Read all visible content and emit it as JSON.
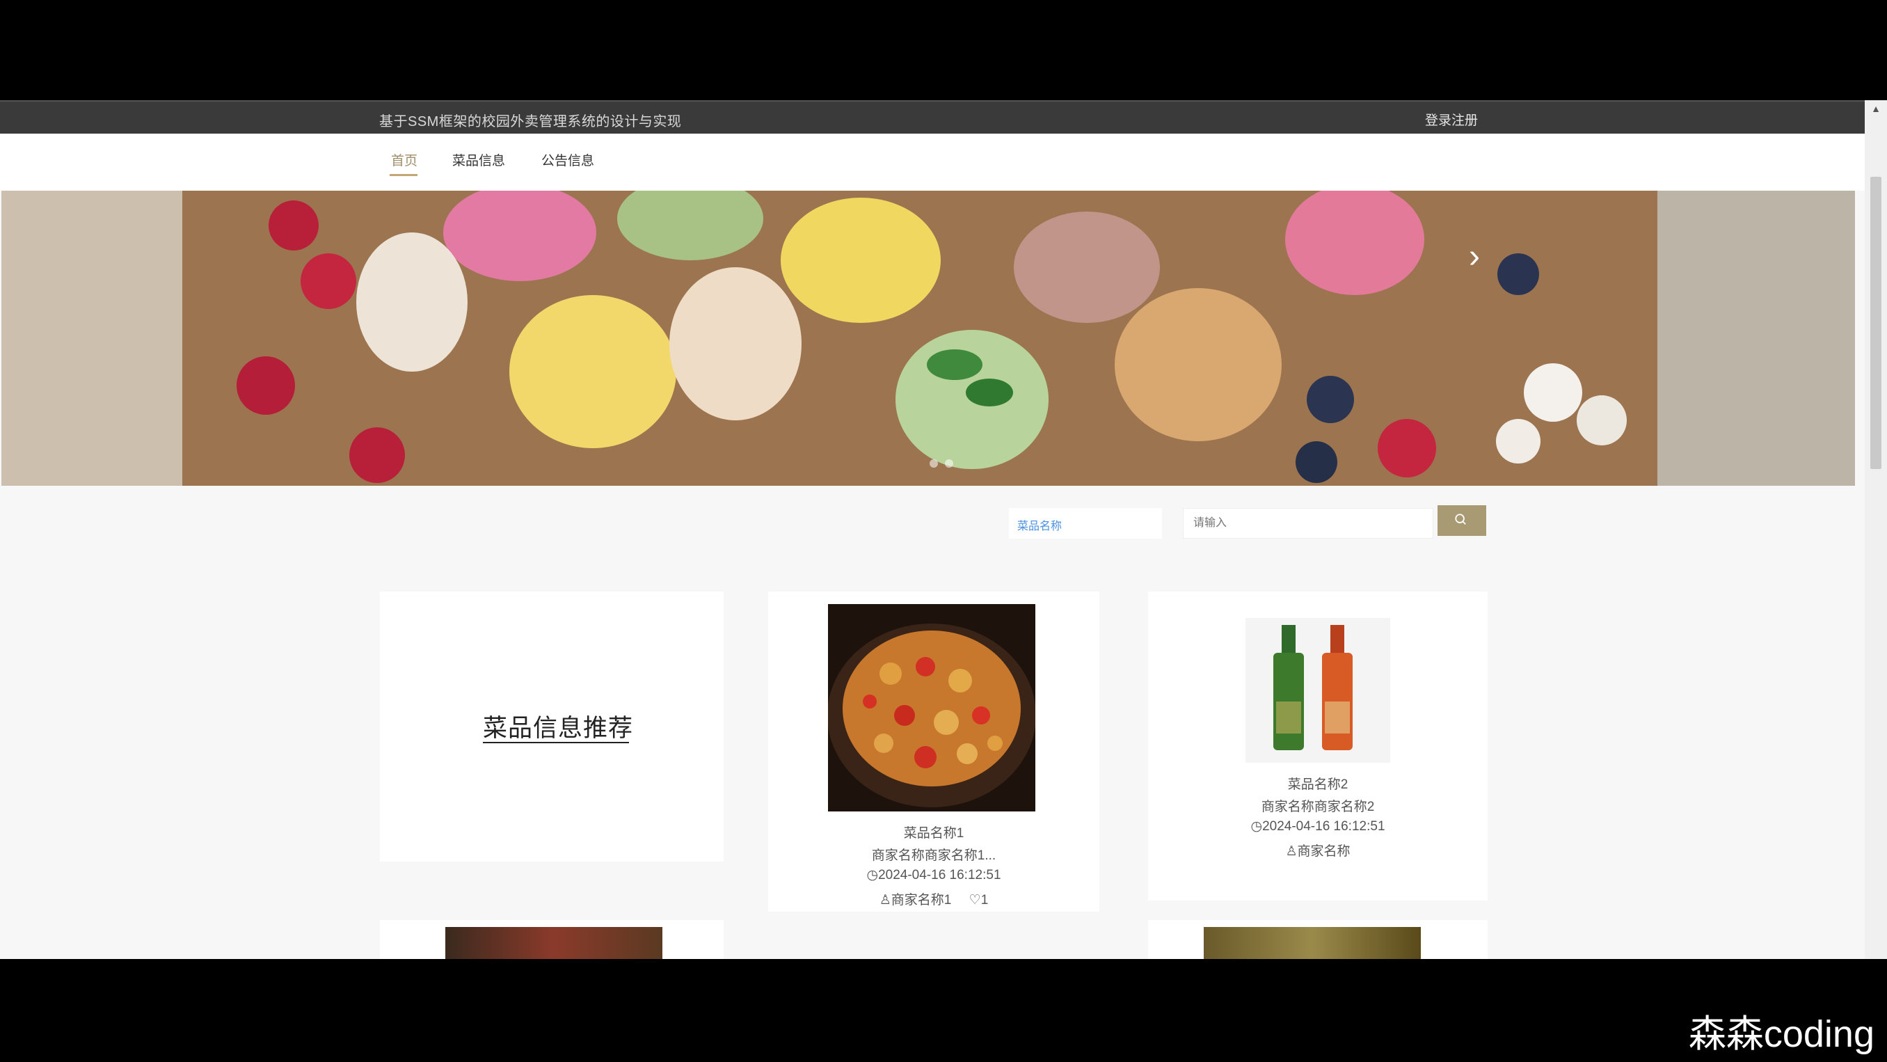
{
  "header": {
    "site_title": "基于SSM框架的校园外卖管理系统的设计与实现",
    "login": "登录注册"
  },
  "nav": {
    "home": "首页",
    "dishes": "菜品信息",
    "notices": "公告信息"
  },
  "search": {
    "label": "菜品名称",
    "placeholder": "请输入"
  },
  "recommend": {
    "title": "菜品信息推荐"
  },
  "cards": [
    {
      "name": "菜品名称1",
      "shop": "商家名称商家名称1...",
      "date": "2024-04-16 16:12:51",
      "owner": "商家名称1",
      "likes": "1"
    },
    {
      "name": "菜品名称2",
      "shop": "商家名称商家名称2",
      "date": "2024-04-16 16:12:51",
      "owner": "商家名称"
    }
  ],
  "watermark": "森森coding",
  "colors": {
    "accent": "#c2a878",
    "search_button": "#a89a72",
    "topbar": "#3a3a3a"
  }
}
